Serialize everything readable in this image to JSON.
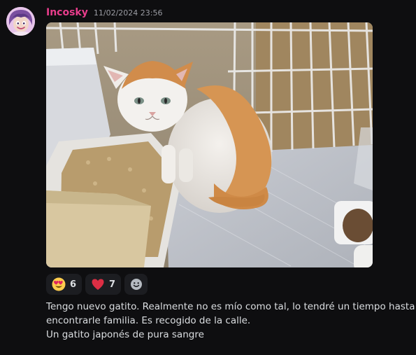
{
  "author": {
    "username": "Incosky",
    "timestamp": "11/02/2024 23:56",
    "avatar_icon": "cartoon-character-avatar",
    "name_color": "#e93d8c"
  },
  "attachment": {
    "type": "image",
    "icon": "cat-in-cage-photo"
  },
  "reactions": [
    {
      "icon": "heart-eyes-emoji",
      "count": "6"
    },
    {
      "icon": "red-heart-emoji",
      "count": "7"
    }
  ],
  "add_reaction": {
    "icon": "add-reaction-icon"
  },
  "message": {
    "lines": [
      "Tengo nuevo gatito. Realmente no es mío como tal, lo tendré un tiempo hasta",
      "encontrarle familia. Es recogido de la calle.",
      "Un gatito japonés de pura sangre"
    ]
  }
}
